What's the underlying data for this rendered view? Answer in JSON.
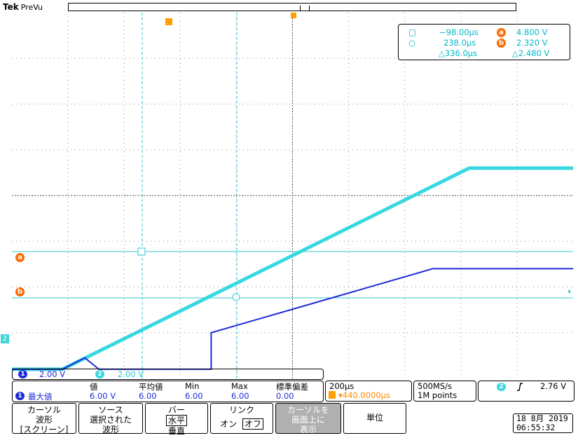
{
  "header": {
    "brand": "Tek",
    "mode": "PreVu"
  },
  "colors": {
    "ch1": "#1f2bd6",
    "ch2": "#38d8e0",
    "cursor": "#ff6a00"
  },
  "cursor_readout": {
    "a_time": "−98.00µs",
    "b_time": "238.0µs",
    "delta_time": "△336.0µs",
    "a_volt": "4.800 V",
    "b_volt": "2.320 V",
    "delta_volt": "△2.480 V",
    "a_label": "a",
    "b_label": "b"
  },
  "channels": {
    "ch1_badge": "1",
    "ch1_scale": "2.00 V",
    "ch2_badge": "2",
    "ch2_scale": "2.00 V"
  },
  "stats": {
    "h_value": "値",
    "h_mean": "平均値",
    "h_min": "Min",
    "h_max": "Max",
    "h_std": "標準偏差",
    "row_label": "最大値",
    "value": "6.00 V",
    "mean": "6.00",
    "min": "6.00",
    "max": "6.00",
    "std": "0.00"
  },
  "timebase": {
    "scale": "200µs",
    "position": "▾440.0000µs"
  },
  "sampling": {
    "rate": "500MS/s",
    "points": "1M points"
  },
  "trigger": {
    "channel": "2",
    "slope_icon": "rising-edge",
    "level": "2.76 V"
  },
  "menu": {
    "b1_l1": "カーソル",
    "b1_l2": "波形",
    "b1_l3": "スクリーン",
    "b2_l1": "ソース",
    "b2_l2": "選択された",
    "b2_l3": "波形",
    "b3_l1": "バー",
    "b3_l2": "水平",
    "b3_l3": "垂直",
    "b4_l1": "リンク",
    "b4_on": "オン",
    "b4_off": "オフ",
    "b5_l1": "カーソルを",
    "b5_l2": "画面上に",
    "b5_l3": "表示",
    "b6_l1": "単位"
  },
  "datetime": {
    "date": "18 8月  2019",
    "time": "06:55:32"
  },
  "chart_data": {
    "type": "line",
    "x_unit": "divisions",
    "y_unit": "divisions",
    "series": [
      {
        "points": [
          [
            0,
            0.2
          ],
          [
            0.9,
            0.2
          ],
          [
            1.3,
            0.45
          ],
          [
            1.55,
            0.2
          ],
          [
            3.55,
            0.2
          ],
          [
            3.55,
            1.0
          ],
          [
            7.5,
            2.4
          ],
          [
            8.0,
            2.4
          ],
          [
            10,
            2.4
          ]
        ]
      },
      {
        "points": [
          [
            0,
            0.2
          ],
          [
            0.9,
            0.2
          ],
          [
            8.15,
            4.6
          ],
          [
            10,
            4.6
          ]
        ]
      }
    ]
  }
}
